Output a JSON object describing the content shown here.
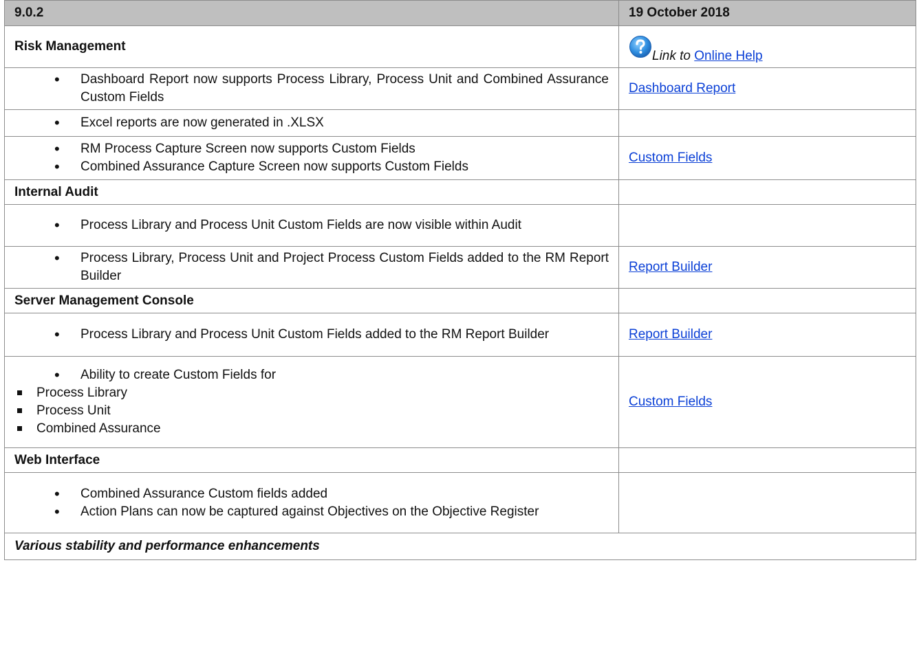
{
  "header": {
    "version": "9.0.2",
    "date": "19 October 2018"
  },
  "sections": {
    "risk": {
      "title": "Risk Management",
      "help_prefix": "Link to",
      "help_link": "Online Help",
      "row1_item": "Dashboard Report now supports Process Library, Process Unit and Combined Assurance Custom Fields",
      "row1_link": "Dashboard Report",
      "row2_item": "Excel reports are now generated in .XLSX",
      "row3_item1": "RM Process Capture Screen now supports Custom Fields",
      "row3_item2": "Combined Assurance Capture Screen now supports Custom Fields",
      "row3_link": "Custom Fields"
    },
    "audit": {
      "title": "Internal Audit",
      "row1_item": "Process Library and Process Unit Custom Fields are now visible within Audit",
      "row2_item": "Process Library, Process Unit and Project Process Custom Fields added to the RM Report Builder",
      "row2_link": "Report Builder"
    },
    "server": {
      "title": "Server Management Console",
      "row1_item": "Process Library and Process Unit Custom Fields added to the RM Report Builder",
      "row1_link": "Report Builder",
      "row2_item": "Ability to create Custom Fields for",
      "row2_sub": [
        "Process Library",
        "Process Unit",
        "Combined Assurance"
      ],
      "row2_link": "Custom Fields"
    },
    "web": {
      "title": "Web Interface",
      "row1_item1": "Combined Assurance Custom fields added",
      "row1_item2": "Action Plans can now be captured against Objectives on the Objective Register"
    }
  },
  "footer": "Various stability and performance enhancements",
  "icons": {
    "help": "help-question-icon"
  },
  "colors": {
    "header_bg": "#bfbfbf",
    "link": "#0a3fd6",
    "icon_blue": "#2f8ee0"
  }
}
